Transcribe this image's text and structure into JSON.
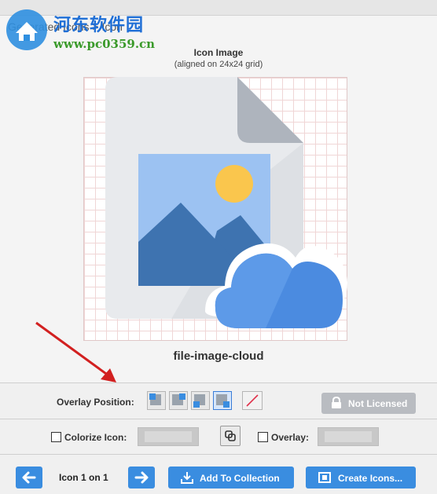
{
  "watermark": {
    "title": "河东软件园",
    "url": "www.pc0359.cn"
  },
  "panel": {
    "header": "Generated Icons > Icon"
  },
  "preview": {
    "title": "Icon Image",
    "subtitle": "(aligned on 24x24 grid)",
    "icon_name": "file-image-cloud",
    "colors": {
      "page": "#e8eaed",
      "page_fold": "#aeb4bd",
      "image_sky": "#9cc2f2",
      "sun": "#fac64d",
      "mountain": "#3e73b0",
      "cloud": "#4b8be0"
    }
  },
  "overlay_position": {
    "label": "Overlay Position:",
    "options": [
      "top-left",
      "top-right",
      "bottom-left",
      "bottom-right"
    ],
    "selected": "bottom-right"
  },
  "license": {
    "label": "Not Licensed"
  },
  "colorize": {
    "label": "Colorize Icon:",
    "checked": false
  },
  "overlay": {
    "label": "Overlay:",
    "checked": false
  },
  "navigation": {
    "label": "Icon 1 on 1"
  },
  "actions": {
    "add_to_collection": "Add To Collection",
    "create_icons": "Create Icons..."
  }
}
